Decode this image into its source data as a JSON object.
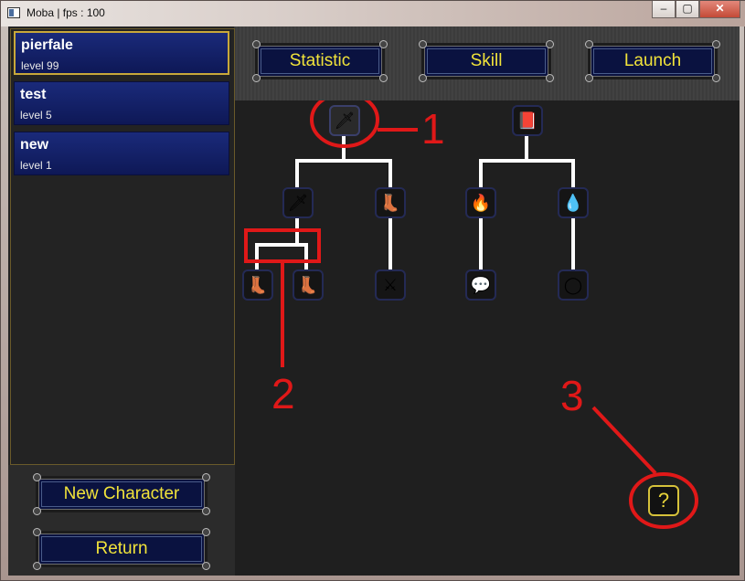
{
  "window": {
    "title": "Moba | fps : 100",
    "minimize": "‒",
    "maximize": "▢",
    "close": "✕"
  },
  "characters": [
    {
      "name": "pierfale",
      "level": "level 99",
      "selected": true
    },
    {
      "name": "test",
      "level": "level 5",
      "selected": false
    },
    {
      "name": "new",
      "level": "level 1",
      "selected": false
    }
  ],
  "left_buttons": {
    "new_character": "New Character",
    "return": "Return"
  },
  "tabs": {
    "statistic": "Statistic",
    "skill": "Skill",
    "launch": "Launch"
  },
  "skills": {
    "sword_root": "🗡",
    "spellbook_root": "📕",
    "golden_sword": "🗡",
    "boot_left": "👢",
    "fire": "🔥",
    "bubbles": "💧",
    "boot_a": "👢",
    "boot_b": "👢",
    "claws": "⚔",
    "speech": "💬",
    "portal": "◯"
  },
  "help": {
    "label": "?"
  },
  "annotations": {
    "one": "1",
    "two": "2",
    "three": "3"
  },
  "colors": {
    "annotation": "#e01818",
    "button_text": "#f1e33a",
    "panel_blue": "#0e1856"
  }
}
